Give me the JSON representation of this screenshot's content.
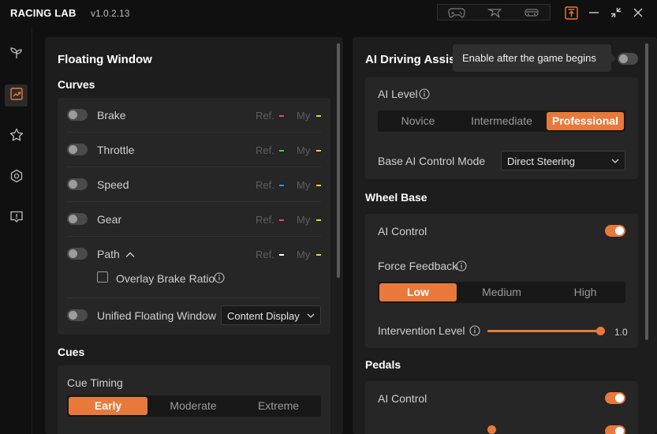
{
  "app": {
    "brand": "RACING LAB",
    "version": "v1.0.2.13"
  },
  "colors": {
    "accent": "#e8793a",
    "ref_red": "#e05050",
    "ref_green": "#3ccf4e",
    "ref_blue": "#3a8de0",
    "my_yellow": "#e8d23a"
  },
  "titlebar_icons": [
    "gamepad-icon",
    "steering-wheel-icon",
    "car-icon",
    "pin-top-icon",
    "minimize-icon",
    "collapse-icon",
    "close-icon"
  ],
  "nav": [
    "sprout-icon",
    "chart-icon",
    "star-icon",
    "hexagon-settings-icon",
    "feedback-icon"
  ],
  "floating_window": {
    "title": "Floating Window",
    "curves_title": "Curves",
    "curves": [
      {
        "label": "Brake",
        "ref": "Ref.",
        "my": "My",
        "ref_color": "#e05050",
        "enabled": false
      },
      {
        "label": "Throttle",
        "ref": "Ref.",
        "my": "My",
        "ref_color": "#3ccf4e",
        "enabled": false
      },
      {
        "label": "Speed",
        "ref": "Ref.",
        "my": "My",
        "ref_color": "#3a8de0",
        "enabled": false
      },
      {
        "label": "Gear",
        "ref": "Ref.",
        "my": "My",
        "ref_color": "#e05050",
        "enabled": false
      },
      {
        "label": "Path",
        "ref": "Ref.",
        "my": "My",
        "ref_color": "#ffffff",
        "enabled": false
      }
    ],
    "overlay_brake_ratio": "Overlay Brake Ratio",
    "unified_label": "Unified Floating Window",
    "unified_select": "Content Display",
    "cues_title": "Cues",
    "cue_timing_label": "Cue Timing",
    "cue_timing_options": [
      "Early",
      "Moderate",
      "Extreme"
    ],
    "cue_timing_selected": "Early"
  },
  "ai_assist": {
    "title": "AI Driving Assis",
    "tooltip": "Enable after the game begins",
    "enabled": false,
    "ai_level_label": "AI Level",
    "ai_level_options": [
      "Novice",
      "Intermediate",
      "Professional"
    ],
    "ai_level_selected": "Professional",
    "control_mode_label": "Base AI Control Mode",
    "control_mode_value": "Direct Steering",
    "wheel_base_title": "Wheel Base",
    "ai_control_label": "AI Control",
    "ai_control_on": true,
    "force_feedback_label": "Force Feedback",
    "force_feedback_options": [
      "Low",
      "Medium",
      "High"
    ],
    "force_feedback_selected": "Low",
    "intervention_label": "Intervention Level",
    "intervention_value": "1.0",
    "pedals_title": "Pedals",
    "pedals_ai_control_label": "AI Control",
    "pedals_ai_control_on": true
  }
}
